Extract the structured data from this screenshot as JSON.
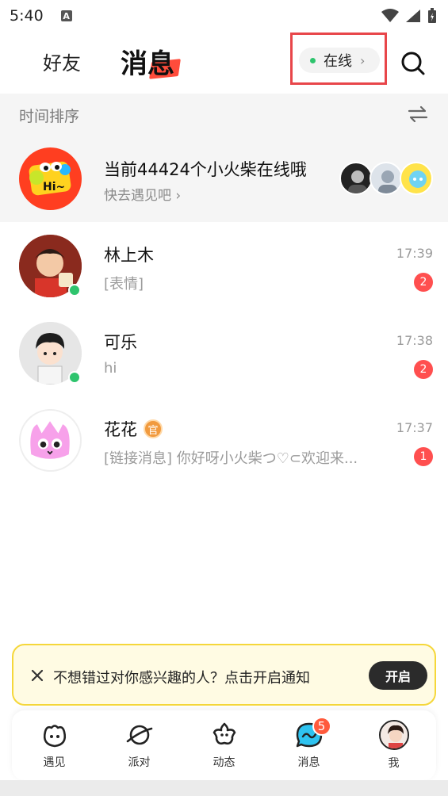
{
  "status_bar": {
    "time": "5:40",
    "notification_letter": "A"
  },
  "header": {
    "tab_friends": "好友",
    "tab_messages": "消息",
    "online_label": "在线",
    "accent_color": "#ff4c3b"
  },
  "sort_bar": {
    "label": "时间排序"
  },
  "banner": {
    "title": "当前44424个小火柴在线哦",
    "subtitle": "快去遇见吧 ›",
    "avatar_text": "Hi~"
  },
  "conversations": [
    {
      "name": "林上木",
      "preview": "[表情]",
      "time": "17:39",
      "unread": "2",
      "online": true
    },
    {
      "name": "可乐",
      "preview": "hi",
      "time": "17:38",
      "unread": "2",
      "online": true
    },
    {
      "name": "花花",
      "preview": "[链接消息] 你好呀小火柴つ♡⊂欢迎来...",
      "time": "17:37",
      "unread": "1",
      "online": false,
      "badge": "官"
    }
  ],
  "notification": {
    "text": "不想错过对你感兴趣的人？点击开启通知",
    "button": "开启"
  },
  "bottom_nav": [
    {
      "label": "遇见",
      "icon": "meet-icon"
    },
    {
      "label": "派对",
      "icon": "planet-icon"
    },
    {
      "label": "动态",
      "icon": "flower-icon"
    },
    {
      "label": "消息",
      "icon": "message-icon",
      "badge": "5"
    },
    {
      "label": "我",
      "icon": "profile-avatar"
    }
  ]
}
